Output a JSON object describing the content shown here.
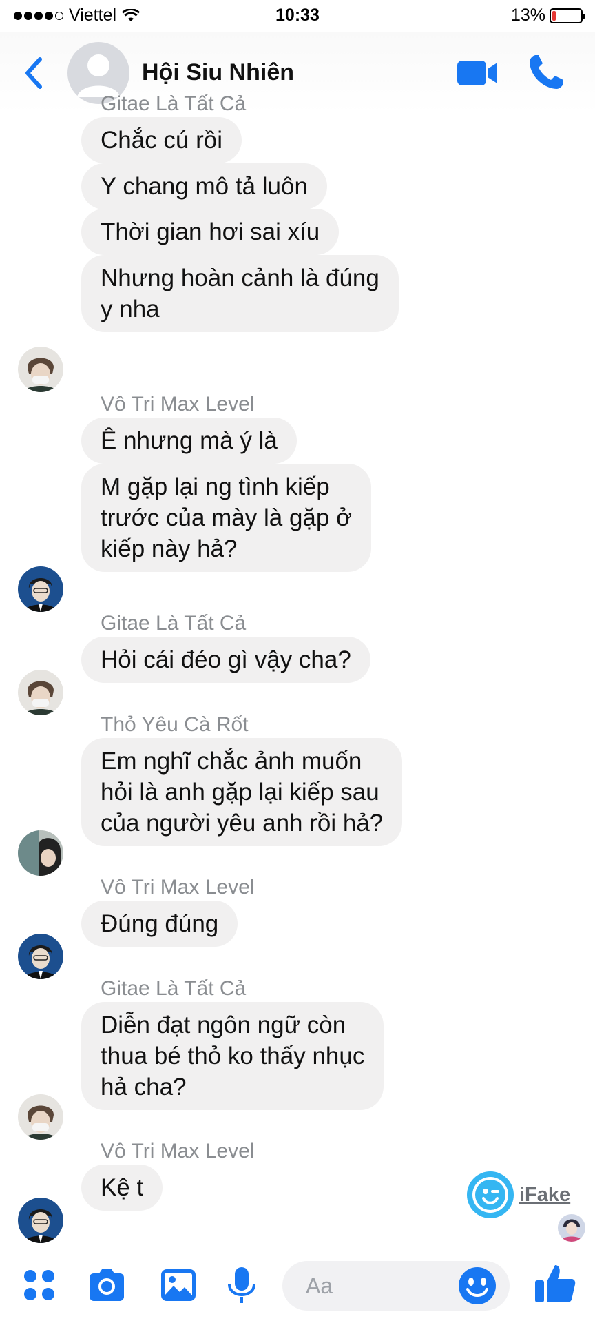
{
  "status_bar": {
    "carrier": "Viettel",
    "time": "10:33",
    "battery_text": "13%",
    "battery_level": 0.13
  },
  "header": {
    "title": "Hội Siu Nhiên"
  },
  "messages": [
    {
      "sender": "Gitae Là Tất Cả",
      "bubbles": [
        "Chắc cú rồi",
        "Y chang mô tả luôn",
        "Thời gian hơi sai xíu",
        "Nhưng hoàn cảnh là đúng\ny nha"
      ]
    },
    {
      "sender": "Vô Tri Max Level",
      "bubbles": [
        "Ê nhưng mà ý là",
        "M gặp lại ng tình kiếp\ntrước của mày là gặp ở\nkiếp này hả?"
      ]
    },
    {
      "sender": "Gitae Là Tất Cả",
      "bubbles": [
        "Hỏi cái đéo gì vậy cha?"
      ]
    },
    {
      "sender": "Thỏ Yêu Cà Rốt",
      "bubbles": [
        "Em nghĩ chắc ảnh muốn\nhỏi là anh gặp lại kiếp sau\ncủa người yêu anh rồi hả?"
      ]
    },
    {
      "sender": "Vô Tri Max Level",
      "bubbles": [
        "Đúng đúng"
      ]
    },
    {
      "sender": "Gitae Là Tất Cả",
      "bubbles": [
        "Diễn đạt ngôn ngữ còn\nthua bé thỏ ko thấy nhục\nhả cha?"
      ]
    },
    {
      "sender": "Vô Tri Max Level",
      "bubbles": [
        "Kệ t"
      ]
    }
  ],
  "watermark": {
    "label": "iFake"
  },
  "composer": {
    "placeholder": "Aa"
  },
  "colors": {
    "accent": "#1877f2",
    "bubble": "#f1f0f0",
    "sender": "#8a8d91"
  }
}
